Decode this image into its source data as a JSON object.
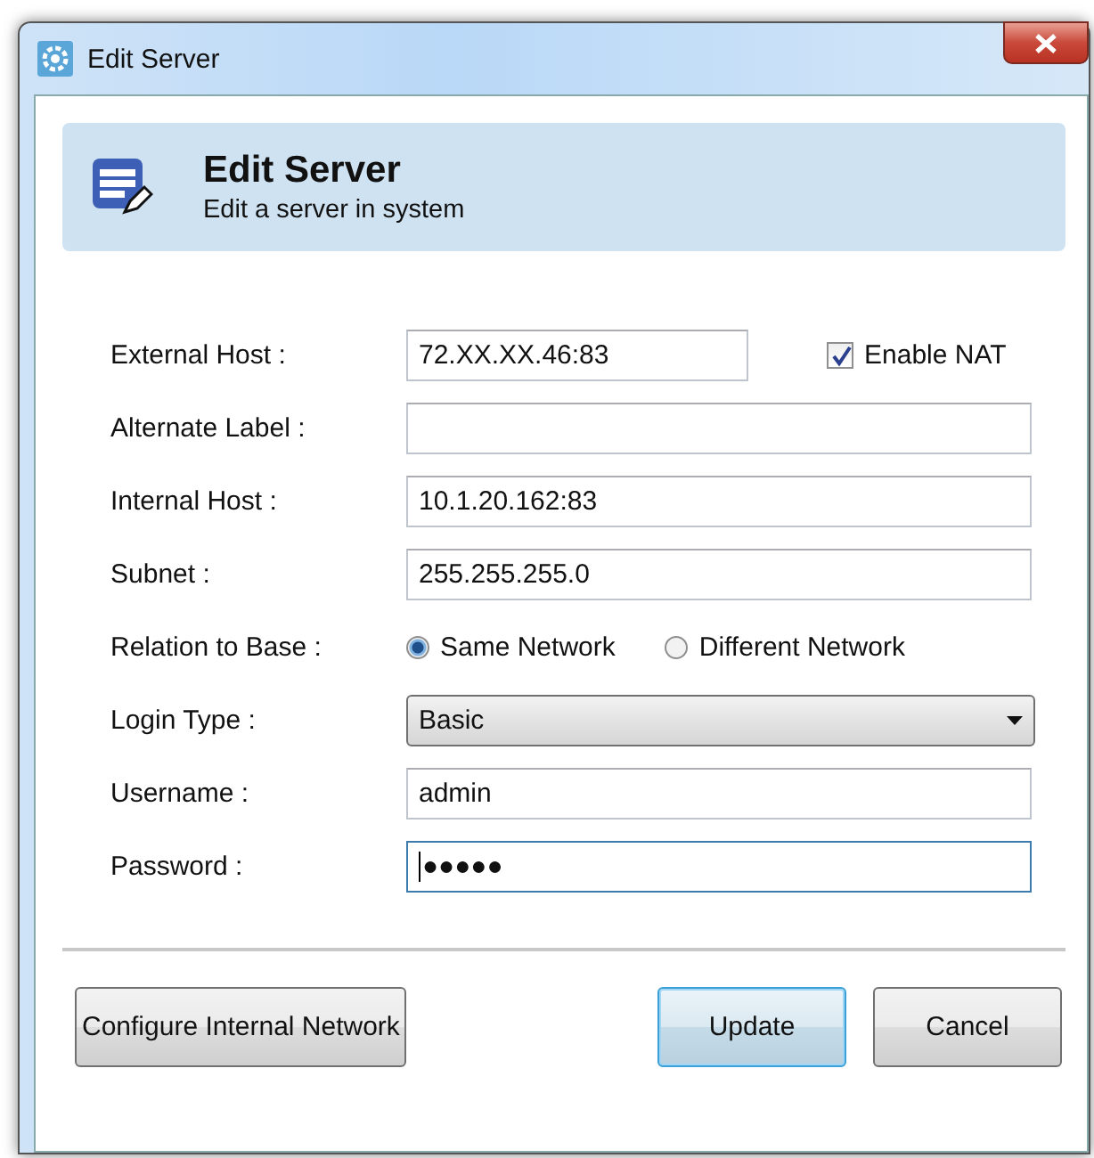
{
  "window": {
    "title": "Edit Server"
  },
  "header": {
    "title": "Edit Server",
    "subtitle": "Edit a server in system"
  },
  "fields": [
    {
      "kind": "text",
      "label": "External Host :",
      "value": "72.XX.XX.46:83",
      "focused": false,
      "checkbox": {
        "label": "Enable NAT",
        "checked": true
      }
    },
    {
      "kind": "text",
      "label": "Alternate Label :",
      "focused": false
    },
    {
      "kind": "text",
      "label": "Internal Host :",
      "value": "10.1.20.162:83",
      "focused": false
    },
    {
      "kind": "text",
      "label": "Subnet :",
      "value": "255.255.255.0",
      "focused": false
    },
    {
      "kind": "radio",
      "label": "Relation to Base :",
      "options": [
        {
          "label": "Same Network",
          "selected": true
        },
        {
          "label": "Different Network",
          "selected": false
        }
      ]
    },
    {
      "kind": "dropdown",
      "label": "Login Type :",
      "value": "Basic"
    },
    {
      "kind": "text",
      "label": "Username :",
      "value": "admin",
      "focused": false
    },
    {
      "kind": "text",
      "label": "Password :",
      "value": "●●●●●",
      "focused": true
    }
  ],
  "footer": {
    "left_buttons": [
      {
        "label": "Configure Internal Network",
        "default": false
      }
    ],
    "right_buttons": [
      {
        "label": "Update",
        "default": true
      },
      {
        "label": "Cancel",
        "default": false
      }
    ]
  }
}
